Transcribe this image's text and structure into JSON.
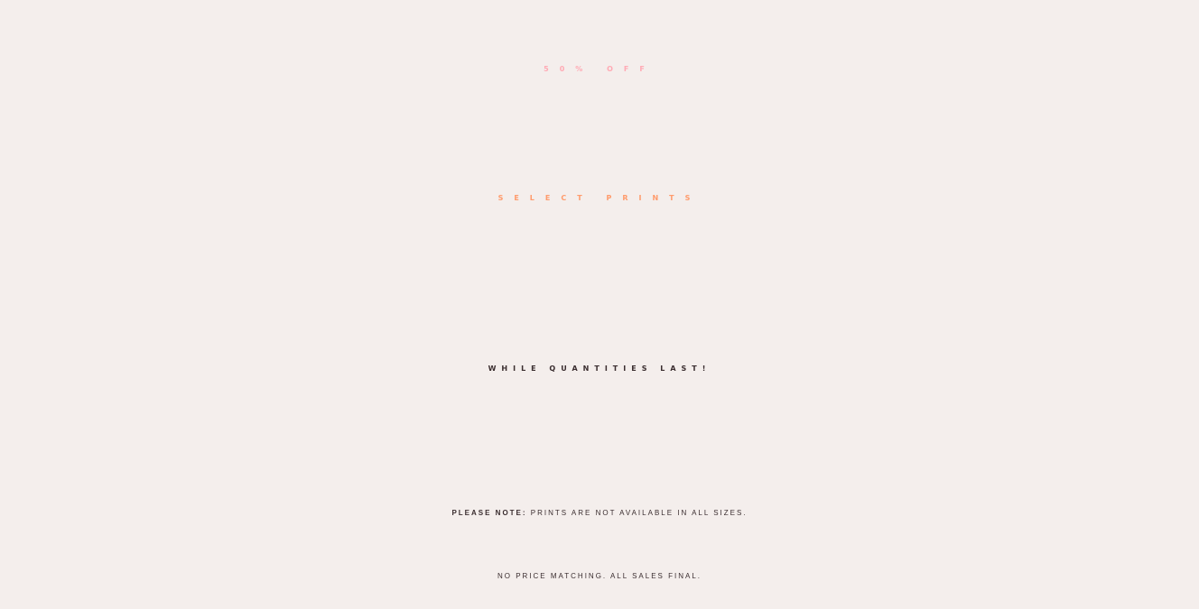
{
  "banner": {
    "headline_line1": "50% OFF",
    "headline_line2": "SELECT PRINTS",
    "tagline": "WHILE QUANTITIES LAST!",
    "note_label": "PLEASE NOTE:",
    "note_text": "PRINTS ARE NOT AVAILABLE IN ALL SIZES.",
    "note_line2": "NO PRICE MATCHING. ALL SALES FINAL."
  },
  "colors": {
    "background": "#f4eeec",
    "headline_line1": "#ffaab4",
    "headline_line2": "#ff9b6c",
    "body_text": "#3a2d2f"
  }
}
